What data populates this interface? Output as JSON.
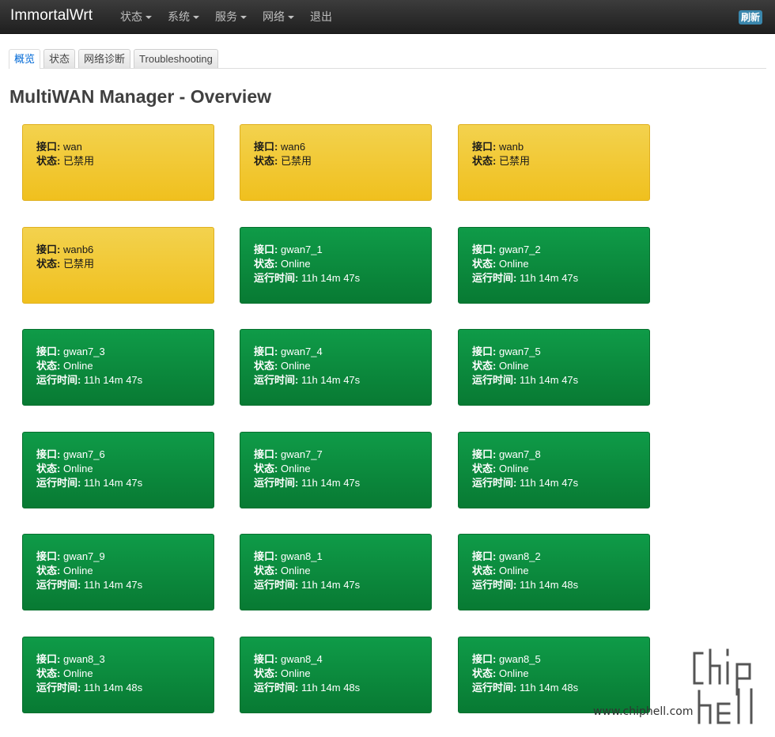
{
  "navbar": {
    "brand": "ImmortalWrt",
    "menu": [
      {
        "label": "状态",
        "dropdown": true
      },
      {
        "label": "系统",
        "dropdown": true
      },
      {
        "label": "服务",
        "dropdown": true
      },
      {
        "label": "网络",
        "dropdown": true
      },
      {
        "label": "退出",
        "dropdown": false
      }
    ],
    "refresh_label": "刷新"
  },
  "tabs": [
    {
      "label": "概览",
      "active": true
    },
    {
      "label": "状态",
      "active": false
    },
    {
      "label": "网络诊断",
      "active": false
    },
    {
      "label": "Troubleshooting",
      "active": false
    }
  ],
  "page_title": "MultiWAN Manager - Overview",
  "labels": {
    "interface": "接口:",
    "status": "状态:",
    "uptime": "运行时间:"
  },
  "colors": {
    "disabled": "#f1c832",
    "online": "#0b8a3e"
  },
  "interfaces": [
    {
      "name": "wan",
      "status": "已禁用",
      "uptime": ""
    },
    {
      "name": "wan6",
      "status": "已禁用",
      "uptime": ""
    },
    {
      "name": "wanb",
      "status": "已禁用",
      "uptime": ""
    },
    {
      "name": "wanb6",
      "status": "已禁用",
      "uptime": ""
    },
    {
      "name": "gwan7_1",
      "status": "Online",
      "uptime": "11h 14m 47s"
    },
    {
      "name": "gwan7_2",
      "status": "Online",
      "uptime": "11h 14m 47s"
    },
    {
      "name": "gwan7_3",
      "status": "Online",
      "uptime": "11h 14m 47s"
    },
    {
      "name": "gwan7_4",
      "status": "Online",
      "uptime": "11h 14m 47s"
    },
    {
      "name": "gwan7_5",
      "status": "Online",
      "uptime": "11h 14m 47s"
    },
    {
      "name": "gwan7_6",
      "status": "Online",
      "uptime": "11h 14m 47s"
    },
    {
      "name": "gwan7_7",
      "status": "Online",
      "uptime": "11h 14m 47s"
    },
    {
      "name": "gwan7_8",
      "status": "Online",
      "uptime": "11h 14m 47s"
    },
    {
      "name": "gwan7_9",
      "status": "Online",
      "uptime": "11h 14m 47s"
    },
    {
      "name": "gwan8_1",
      "status": "Online",
      "uptime": "11h 14m 47s"
    },
    {
      "name": "gwan8_2",
      "status": "Online",
      "uptime": "11h 14m 48s"
    },
    {
      "name": "gwan8_3",
      "status": "Online",
      "uptime": "11h 14m 48s"
    },
    {
      "name": "gwan8_4",
      "status": "Online",
      "uptime": "11h 14m 48s"
    },
    {
      "name": "gwan8_5",
      "status": "Online",
      "uptime": "11h 14m 48s"
    }
  ],
  "watermark": {
    "url": "www.chiphell.com",
    "logo": "chip hell"
  }
}
